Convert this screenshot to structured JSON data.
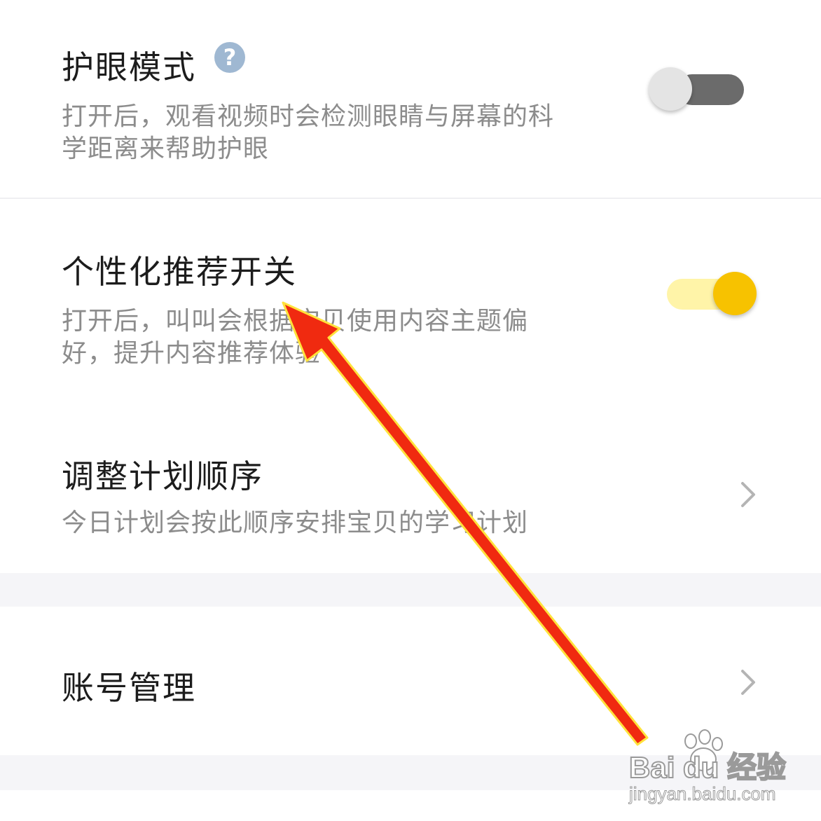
{
  "settings": {
    "eye_mode": {
      "title": "护眼模式",
      "desc_line1": "打开后，观看视频时会检测眼睛与屏幕的科",
      "desc_line2": "学距离来帮助护眼",
      "help_icon": "question-circle-icon",
      "enabled": false
    },
    "personalized": {
      "title": "个性化推荐开关",
      "desc_line1": "打开后，叫叫会根据宝贝使用内容主题偏",
      "desc_line2": "好，提升内容推荐体验",
      "enabled": true
    },
    "plan_order": {
      "title": "调整计划顺序",
      "desc_line1": "今日计划会按此顺序安排宝贝的学习计划",
      "chevron_icon": "chevron-right-icon"
    },
    "account": {
      "title": "账号管理",
      "chevron_icon": "chevron-right-icon"
    }
  },
  "annotation": {
    "arrow_color": "#f02a10",
    "arrow_outline": "#ffe23c"
  },
  "watermark": {
    "logo": "Bai du 经验",
    "url": "jingyan.baidu.com"
  },
  "colors": {
    "toggle_on_knob": "#f7c200",
    "toggle_on_track": "#fff4a8",
    "toggle_off_knob": "#e4e4e4",
    "toggle_off_track": "#6b6b6b",
    "help_icon": "#9fb8d2"
  }
}
